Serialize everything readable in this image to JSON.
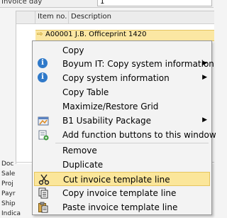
{
  "header": {
    "invoice_day_label": "Invoice day",
    "invoice_day_value": "1"
  },
  "grid": {
    "columns": [
      "Item no.",
      "Description"
    ],
    "selected_row": "A00001 J.B. Officeprint 1420"
  },
  "form_labels": [
    "Doc",
    "Sale",
    "Proj",
    "Payr",
    "Ship",
    "Indica"
  ],
  "context_menu": {
    "items": [
      {
        "label": "Copy",
        "icon": "",
        "submenu": false
      },
      {
        "label": "Boyum IT: Copy system information",
        "icon": "info-icon",
        "submenu": true
      },
      {
        "label": "Copy system information",
        "icon": "info-icon",
        "submenu": true
      },
      {
        "label": "Copy Table",
        "icon": "",
        "submenu": false
      },
      {
        "label": "Maximize/Restore Grid",
        "icon": "",
        "submenu": false
      },
      {
        "label": "B1 Usability Package",
        "icon": "b1-usability-package-icon",
        "submenu": true
      },
      {
        "label": "Add function buttons to this window",
        "icon": "add-function-buttons-icon",
        "submenu": false
      },
      {
        "label": "Remove",
        "icon": "",
        "submenu": false
      },
      {
        "label": "Duplicate",
        "icon": "",
        "submenu": false
      },
      {
        "label": "Cut invoice template line",
        "icon": "scissors-icon",
        "submenu": false,
        "highlighted": true
      },
      {
        "label": "Copy invoice template line",
        "icon": "copy-document-icon",
        "submenu": false
      },
      {
        "label": "Paste invoice template line",
        "icon": "paste-clipboard-icon",
        "submenu": false
      }
    ]
  },
  "colors": {
    "highlight": "#fbe69a",
    "info_icon": "#2f79c9",
    "selected_row": "#fbe7a3"
  }
}
